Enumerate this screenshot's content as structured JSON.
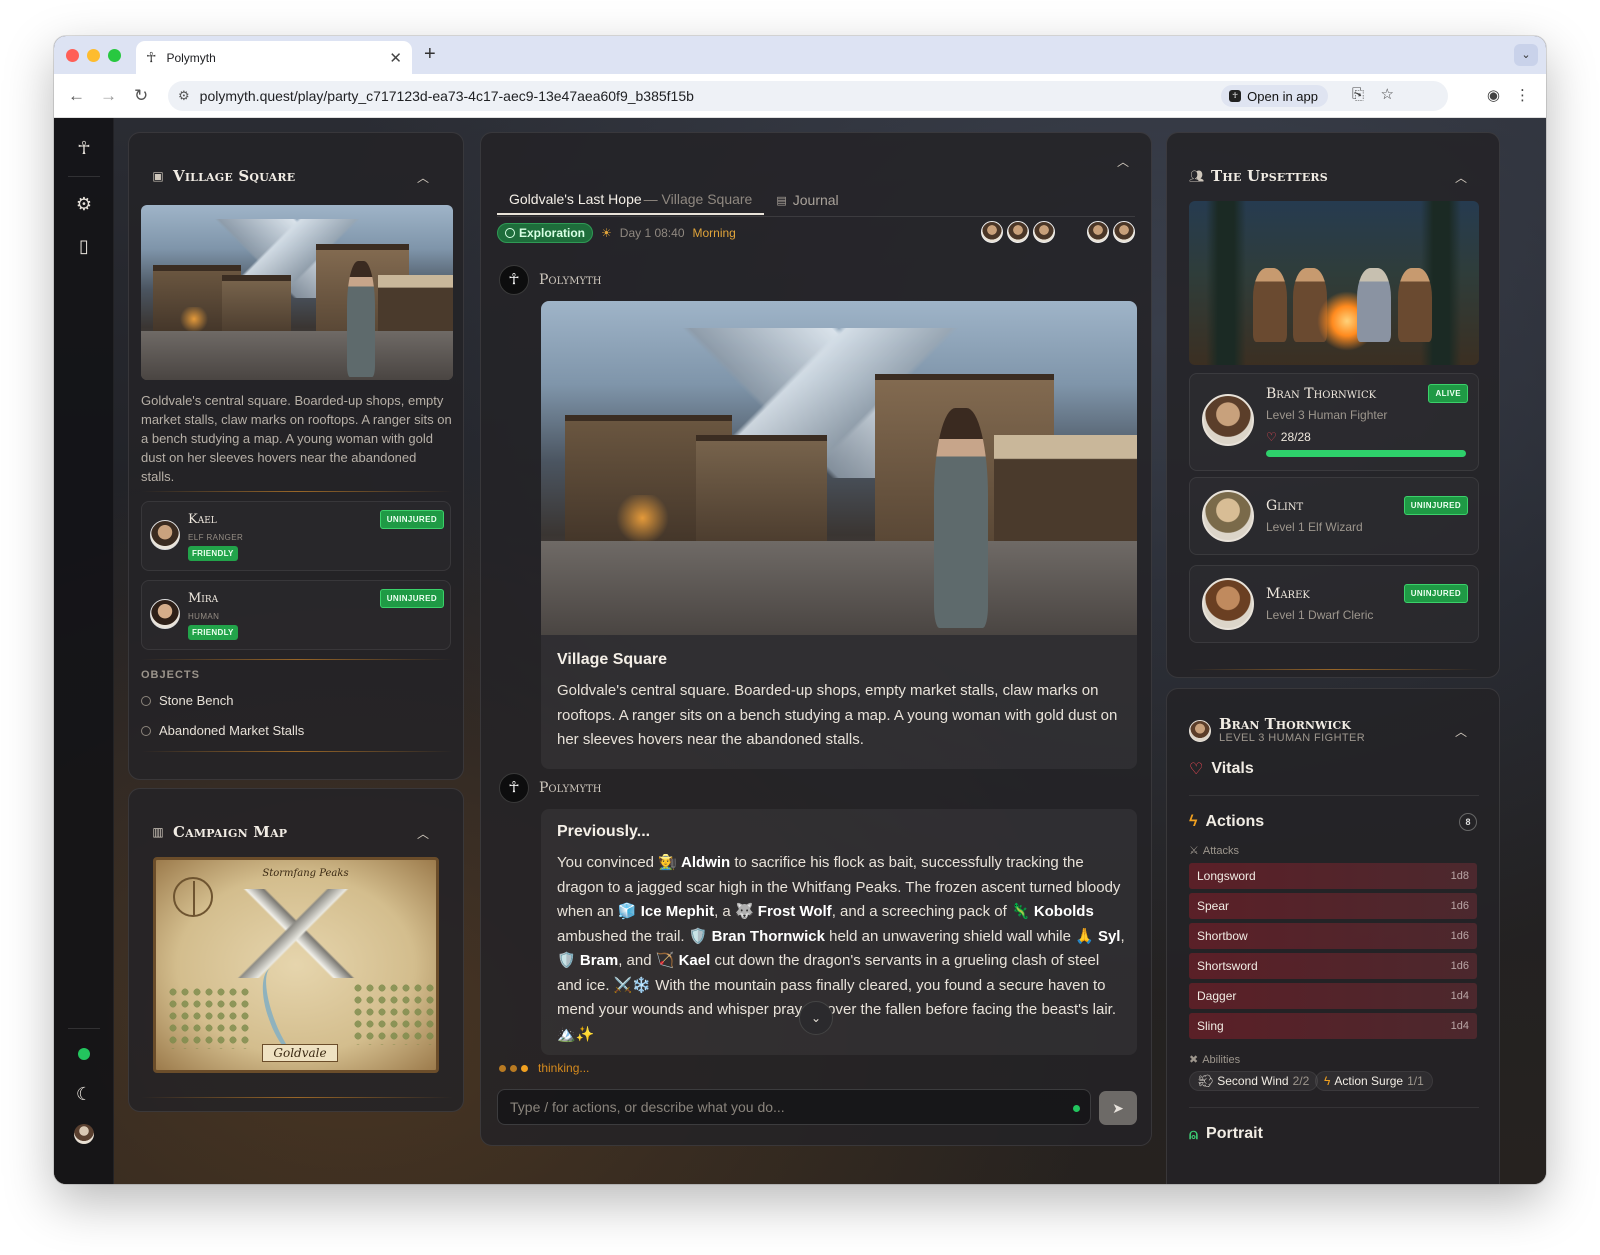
{
  "browser": {
    "tab_title": "Polymyth",
    "tab_close": "✕",
    "new_tab": "+",
    "url": "polymyth.quest/play/party_c717123d-ea73-4c17-aec9-13e47aea60f9_b385f15b",
    "open_in_app": "Open in app"
  },
  "left": {
    "scene": {
      "title": "Village Square",
      "description": "Goldvale's central square. Boarded-up shops, empty market stalls, claw marks on rooftops. A ranger sits on a bench studying a map. A young woman with gold dust on her sleeves hovers near the abandoned stalls.",
      "npcs": [
        {
          "name": "Kael",
          "subtitle": "ELF RANGER",
          "disposition": "FRIENDLY",
          "status": "UNINJURED"
        },
        {
          "name": "Mira",
          "subtitle": "HUMAN",
          "disposition": "FRIENDLY",
          "status": "UNINJURED"
        }
      ],
      "objects_label": "OBJECTS",
      "objects": [
        "Stone Bench",
        "Abandoned Market Stalls"
      ]
    },
    "map": {
      "title": "Campaign Map",
      "labels": {
        "peaks": "Stormfang Peaks",
        "town": "Goldvale"
      }
    }
  },
  "center": {
    "tab_active": "Goldvale's Last Hope",
    "tab_active_suffix": "— Village Square",
    "tab_journal": "Journal",
    "status": {
      "mode": "Exploration",
      "day_time": "Day 1 08:40",
      "period": "Morning"
    },
    "messages": [
      {
        "author": "Polymyth",
        "title": "Village Square",
        "text": "Goldvale's central square. Boarded-up shops, empty market stalls, claw marks on rooftops. A ranger sits on a bench studying a map. A young woman with gold dust on her sleeves hovers near the abandoned stalls."
      },
      {
        "author": "Polymyth",
        "title": "Previously...",
        "parts": {
          "p1": "You convinced 🧑‍🌾 ",
          "aldwin": "Aldwin",
          "p2": " to sacrifice his flock as bait, successfully tracking the dragon to a jagged scar high in the Whitfang Peaks. The frozen ascent turned bloody when an 🧊 ",
          "ice_mephit": "Ice Mephit",
          "p3": ", a 🐺 ",
          "frost_wolf": "Frost Wolf",
          "p4": ", and a screeching pack of 🦎 ",
          "kobolds": "Kobolds",
          "p5": " ambushed the trail. 🛡️ ",
          "bran": "Bran Thornwick",
          "p6": " held an unwavering shield wall while 🙏 ",
          "syl": "Syl",
          "p7": ", 🛡️ ",
          "bram": "Bram",
          "p8": ", and 🏹 ",
          "kael": "Kael",
          "p9": " cut down the dragon's servants in a grueling clash of steel and ice. ⚔️❄️ With the mountain pass finally cleared, you found a secure haven to mend your wounds and whisper prayers over the fallen before facing the beast's lair. 🏔️✨"
        }
      }
    ],
    "thinking": "thinking...",
    "input_placeholder": "Type / for actions, or describe what you do..."
  },
  "right": {
    "party": {
      "title": "The Upsetters",
      "members": [
        {
          "name": "Bran Thornwick",
          "desc": "Level 3 Human Fighter",
          "status": "ALIVE",
          "hp": "28/28",
          "hp_fraction": 1.0
        },
        {
          "name": "Glint",
          "desc": "Level 1 Elf Wizard",
          "status": "UNINJURED"
        },
        {
          "name": "Marek",
          "desc": "Level 1 Dwarf Cleric",
          "status": "UNINJURED"
        }
      ]
    },
    "sheet": {
      "name": "Bran Thornwick",
      "subtitle": "LEVEL 3 HUMAN FIGHTER",
      "vitals": "Vitals",
      "actions": "Actions",
      "actions_count": "8",
      "attacks_label": "Attacks",
      "attacks": [
        {
          "name": "Longsword",
          "die": "1d8"
        },
        {
          "name": "Spear",
          "die": "1d6"
        },
        {
          "name": "Shortbow",
          "die": "1d6"
        },
        {
          "name": "Shortsword",
          "die": "1d6"
        },
        {
          "name": "Dagger",
          "die": "1d4"
        },
        {
          "name": "Sling",
          "die": "1d4"
        }
      ],
      "abilities_label": "Abilities",
      "abilities": [
        {
          "name": "Second Wind",
          "uses": "2/2"
        },
        {
          "name": "Action Surge",
          "uses": "1/1"
        }
      ],
      "portrait": "Portrait"
    }
  },
  "colors": {
    "accent_amber": "#e0a43a",
    "status_green": "#22c55e",
    "danger_red": "#ff4d5a"
  }
}
